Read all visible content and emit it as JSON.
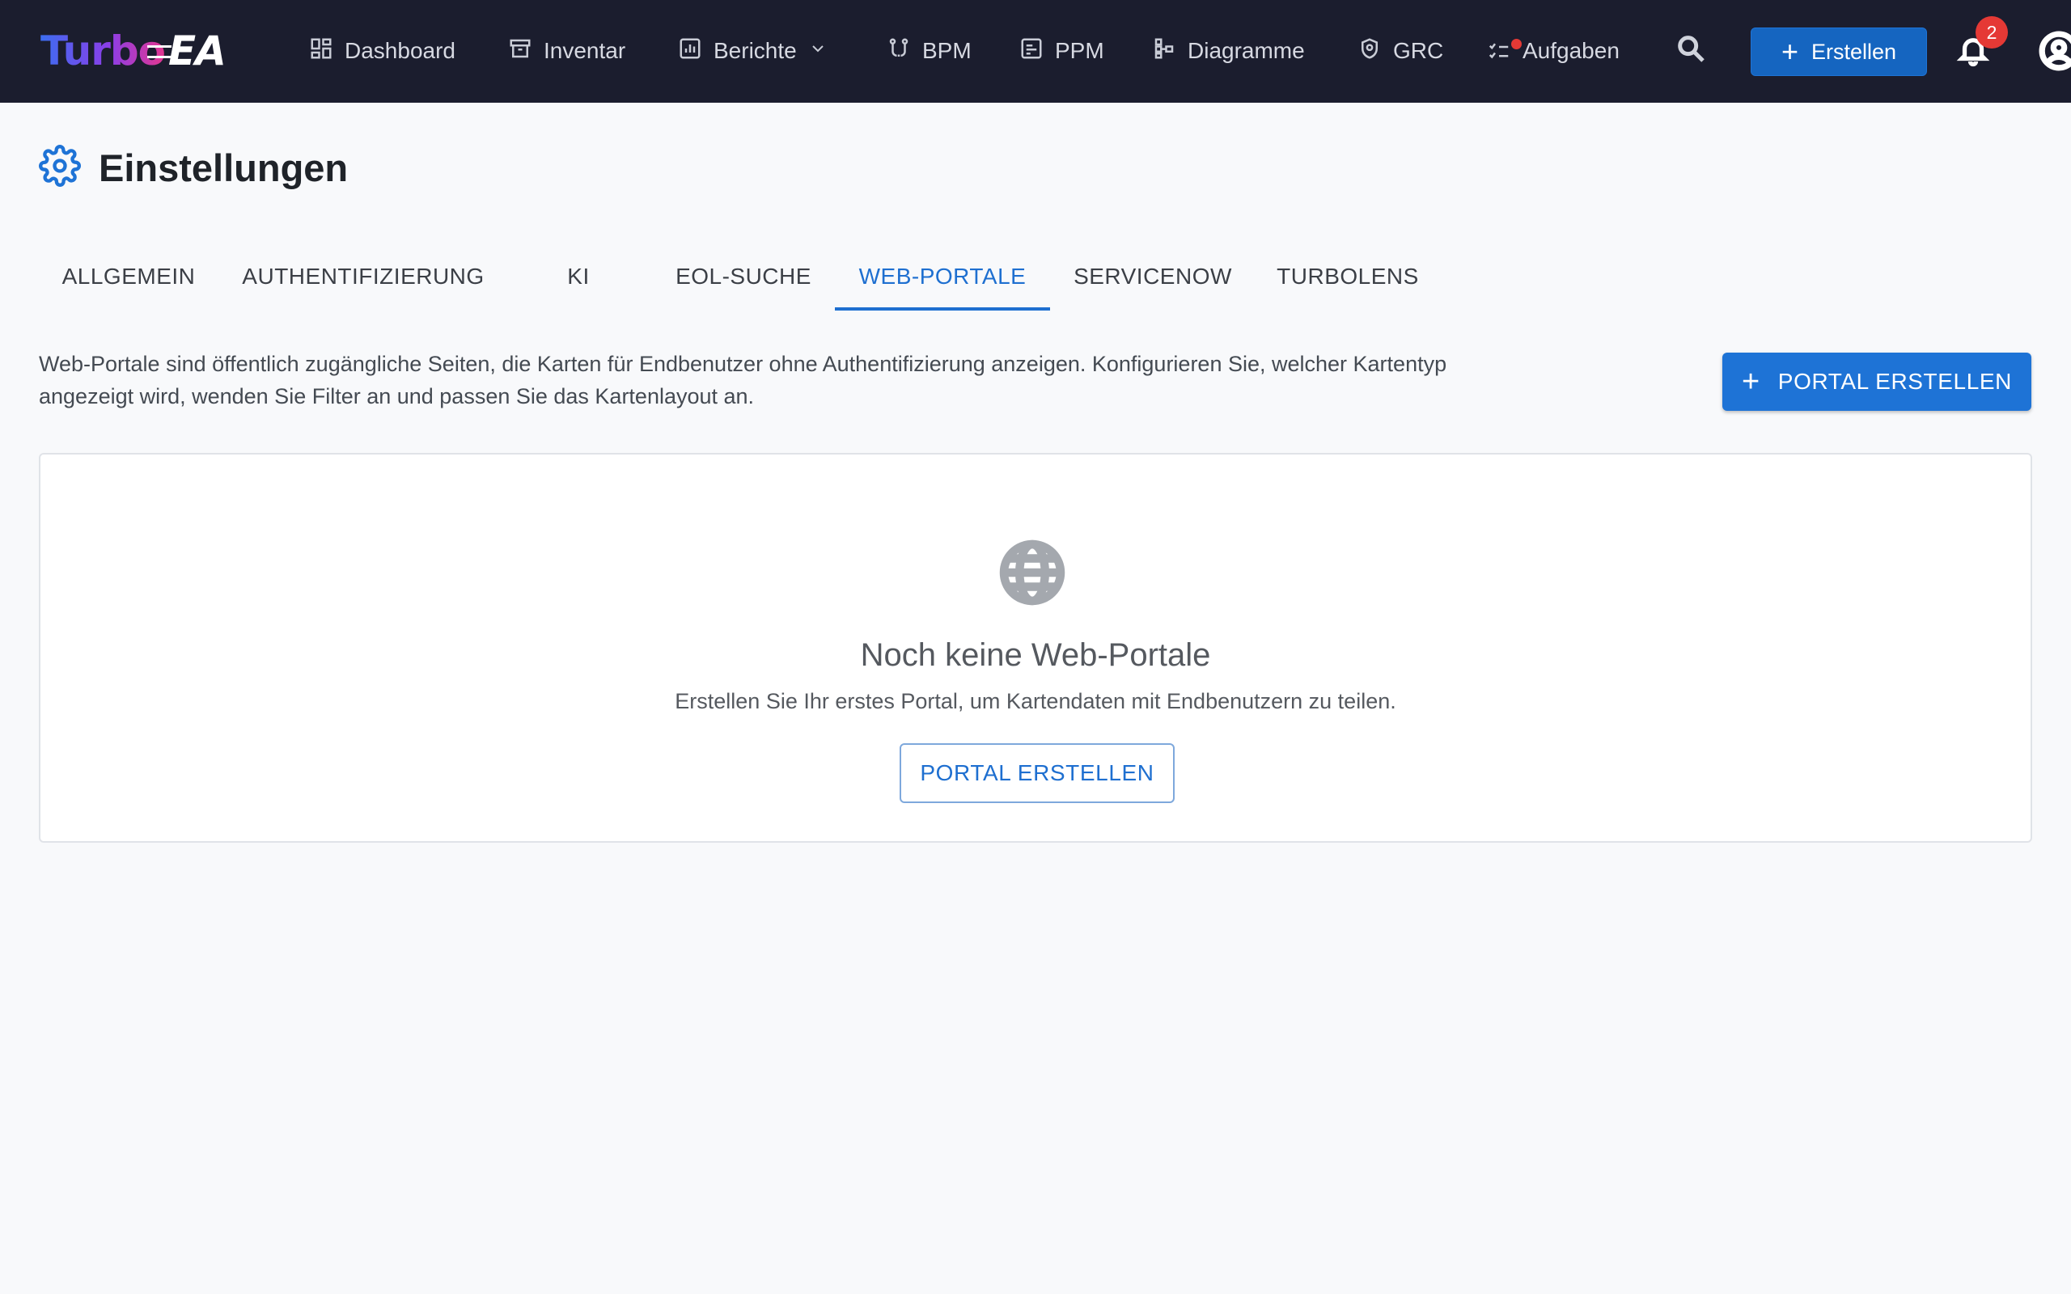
{
  "app": {
    "logo_turbo": "Turbo",
    "logo_ea": "EA"
  },
  "nav": {
    "items": [
      {
        "label": "Dashboard",
        "icon": "dashboard-icon"
      },
      {
        "label": "Inventar",
        "icon": "archive-icon"
      },
      {
        "label": "Berichte",
        "icon": "report-icon",
        "dropdown": true
      },
      {
        "label": "BPM",
        "icon": "process-icon"
      },
      {
        "label": "PPM",
        "icon": "project-icon"
      },
      {
        "label": "Diagramme",
        "icon": "diagram-icon"
      },
      {
        "label": "GRC",
        "icon": "shield-icon"
      },
      {
        "label": "Aufgaben",
        "icon": "tasks-icon",
        "has_dot": true
      }
    ],
    "create_label": "Erstellen",
    "notification_count": "2"
  },
  "page": {
    "title": "Einstellungen"
  },
  "tabs": [
    {
      "label": "ALLGEMEIN",
      "active": false
    },
    {
      "label": "AUTHENTIFIZIERUNG",
      "active": false
    },
    {
      "label": "KI",
      "active": false
    },
    {
      "label": "EOL-SUCHE",
      "active": false
    },
    {
      "label": "WEB-PORTALE",
      "active": true
    },
    {
      "label": "SERVICENOW",
      "active": false
    },
    {
      "label": "TURBOLENS",
      "active": false
    }
  ],
  "web_portals": {
    "description_line1": "Web-Portale sind öffentlich zugängliche Seiten, die Karten für Endbenutzer ohne Authentifizierung anzeigen. Konfigurieren Sie, welcher Kartentyp",
    "description_line2": "angezeigt wird, wenden Sie Filter an und passen Sie das Kartenlayout an.",
    "create_button": "PORTAL ERSTELLEN",
    "empty_title": "Noch keine Web-Portale",
    "empty_subtitle": "Erstellen Sie Ihr erstes Portal, um Kartendaten mit Endbenutzern zu teilen.",
    "empty_button": "PORTAL ERSTELLEN"
  },
  "colors": {
    "navbar": "#1b1d2e",
    "primary": "#1e73d6",
    "badge": "#e53935"
  }
}
